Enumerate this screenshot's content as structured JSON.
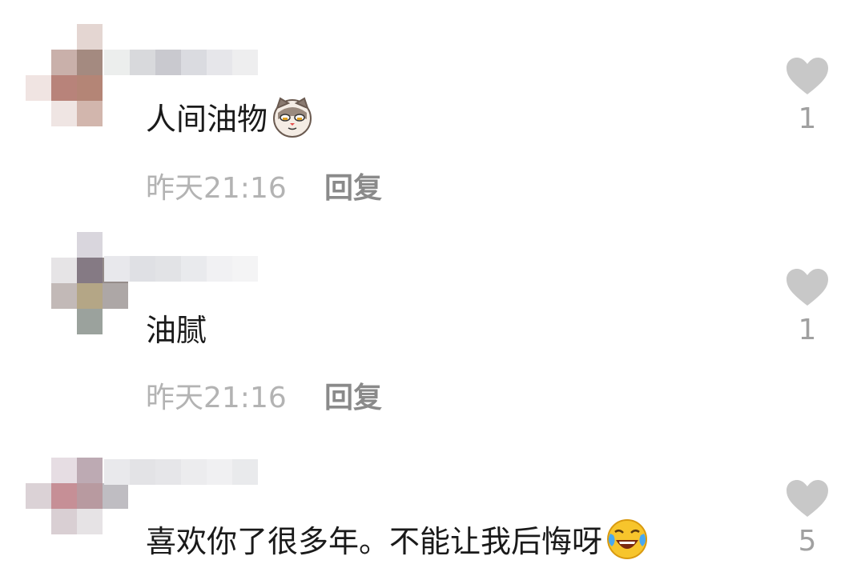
{
  "comments": [
    {
      "text": "人间油物",
      "emoji": "smug-cat-emoji",
      "time": "昨天21:16",
      "reply_label": "回复",
      "likes": "1",
      "avatar_colors": [
        "#e4d6d2",
        "#a48a80",
        "#b8837a",
        "#efe5e3",
        "#c9b0aa",
        "#b48576",
        "#d2b6ad",
        "#f0e4e2"
      ],
      "name_colors": [
        "#eceeed",
        "#d8d9dc",
        "#c9c9cf",
        "#dadbe0",
        "#e6e6ea",
        "#eeeeef"
      ]
    },
    {
      "text": "油腻",
      "emoji": "",
      "time": "昨天21:16",
      "reply_label": "回复",
      "likes": "1",
      "avatar_colors": [
        "#d9d6dd",
        "#857a84",
        "#958c8a",
        "#e6e4e6",
        "#b4a686",
        "#ada7a6",
        "#c2b9b7",
        "#9ba29d"
      ],
      "name_colors": [
        "#e8e8ec",
        "#dfe0e4",
        "#e2e3e6",
        "#e9eaed",
        "#f1f1f3",
        "#f4f4f5"
      ]
    },
    {
      "text": "喜欢你了很多年。不能让我后悔呀",
      "emoji": "laughing-tears-emoji",
      "time": "",
      "reply_label": "",
      "likes": "5",
      "avatar_colors": [
        "#e6dde3",
        "#bdaab3",
        "#c68f96",
        "#d9cfd3",
        "#b89aa0",
        "#bfbdc2",
        "#dbd2d6",
        "#e6e3e5"
      ],
      "name_colors": [
        "#e9e9ec",
        "#e3e3e6",
        "#e6e6e9",
        "#ececee",
        "#f0f0f2",
        "#e9eaec"
      ]
    }
  ],
  "colors": {
    "text": "#1a1a1a",
    "meta": "#b3b3b3",
    "reply": "#8a8a8a",
    "heart": "#c8c8c8",
    "count": "#a0a0a0"
  }
}
